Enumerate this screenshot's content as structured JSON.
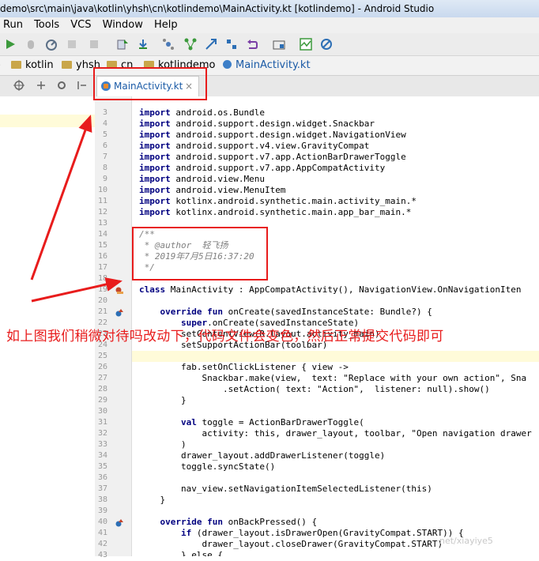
{
  "window": {
    "title": "demo\\src\\main\\java\\kotlin\\yhsh\\cn\\kotlindemo\\MainActivity.kt [kotlindemo] - Android Studio"
  },
  "menu": {
    "items": [
      "Run",
      "Tools",
      "VCS",
      "Window",
      "Help"
    ]
  },
  "breadcrumbs": [
    "kotlin",
    "yhsh",
    "cn",
    "kotlindemo",
    "MainActivity.kt"
  ],
  "editor_tab": {
    "label": "MainActivity.kt",
    "close": "×"
  },
  "annotation": {
    "caption": "如上图我们稍微对待吗改动下，代码文件会变色，然后正常提交代码即可",
    "watermark": "net/xiayiye5"
  },
  "code": {
    "line_numbers": [
      "3",
      "4",
      "5",
      "6",
      "7",
      "8",
      "9",
      "10",
      "11",
      "12",
      "13",
      "14",
      "15",
      "16",
      "17",
      "18",
      "19",
      "20",
      "21",
      "22",
      "23",
      "24",
      "25",
      "26",
      "27",
      "28",
      "29",
      "30",
      "31",
      "32",
      "33",
      "34",
      "35",
      "36",
      "37",
      "38",
      "39",
      "40",
      "41",
      "42",
      "43"
    ],
    "lines": [
      {
        "pre": "import ",
        "rest": "android.os.Bundle"
      },
      {
        "pre": "import ",
        "rest": "android.support.design.widget.Snackbar"
      },
      {
        "pre": "import ",
        "rest": "android.support.design.widget.NavigationView"
      },
      {
        "pre": "import ",
        "rest": "android.support.v4.view.GravityCompat"
      },
      {
        "pre": "import ",
        "rest": "android.support.v7.app.ActionBarDrawerToggle"
      },
      {
        "pre": "import ",
        "rest": "android.support.v7.app.AppCompatActivity"
      },
      {
        "pre": "import ",
        "rest": "android.view.Menu"
      },
      {
        "pre": "import ",
        "rest": "android.view.MenuItem"
      },
      {
        "pre": "import ",
        "rest": "kotlinx.android.synthetic.main.activity_main.*"
      },
      {
        "pre": "import ",
        "rest": "kotlinx.android.synthetic.main.app_bar_main.*"
      },
      {
        "pre": "",
        "rest": ""
      },
      {
        "pre": "",
        "rest": "/**"
      },
      {
        "pre": "",
        "rest": " * @author  轻飞扬"
      },
      {
        "pre": "",
        "rest": " * 2019年7月5日16:37:20"
      },
      {
        "pre": "",
        "rest": " */"
      },
      {
        "pre": "",
        "rest": ""
      },
      {
        "pre": "class ",
        "rest": "MainActivity : AppCompatActivity(), NavigationView.OnNavigationIten"
      },
      {
        "pre": "",
        "rest": ""
      },
      {
        "pre": "    override fun ",
        "rest": "onCreate(savedInstanceState: Bundle?) {"
      },
      {
        "pre": "        super",
        "rest": ".onCreate(savedInstanceState)"
      },
      {
        "pre": "        ",
        "rest": "setContentView(R.layout.activity_main)"
      },
      {
        "pre": "        ",
        "rest": "setSupportActionBar(toolbar)"
      },
      {
        "pre": "",
        "rest": ""
      },
      {
        "pre": "        ",
        "rest": "fab.setOnClickListener { view ->"
      },
      {
        "pre": "            ",
        "rest": "Snackbar.make(view,  text: \"Replace with your own action\", Sna"
      },
      {
        "pre": "                ",
        "rest": ".setAction( text: \"Action\",  listener: null).show()"
      },
      {
        "pre": "        ",
        "rest": "}"
      },
      {
        "pre": "",
        "rest": ""
      },
      {
        "pre": "        val ",
        "rest": "toggle = ActionBarDrawerToggle("
      },
      {
        "pre": "            ",
        "rest": "activity: this, drawer_layout, toolbar, \"Open navigation drawer"
      },
      {
        "pre": "        ",
        "rest": ")"
      },
      {
        "pre": "        ",
        "rest": "drawer_layout.addDrawerListener(toggle)"
      },
      {
        "pre": "        ",
        "rest": "toggle.syncState()"
      },
      {
        "pre": "",
        "rest": ""
      },
      {
        "pre": "        ",
        "rest": "nav_view.setNavigationItemSelectedListener(this)"
      },
      {
        "pre": "    ",
        "rest": "}"
      },
      {
        "pre": "",
        "rest": ""
      },
      {
        "pre": "    override fun ",
        "rest": "onBackPressed() {"
      },
      {
        "pre": "        if ",
        "rest": "(drawer_layout.isDrawerOpen(GravityCompat.START)) {"
      },
      {
        "pre": "            ",
        "rest": "drawer_layout.closeDrawer(GravityCompat.START)"
      },
      {
        "pre": "        ",
        "rest": "} else {"
      }
    ]
  }
}
